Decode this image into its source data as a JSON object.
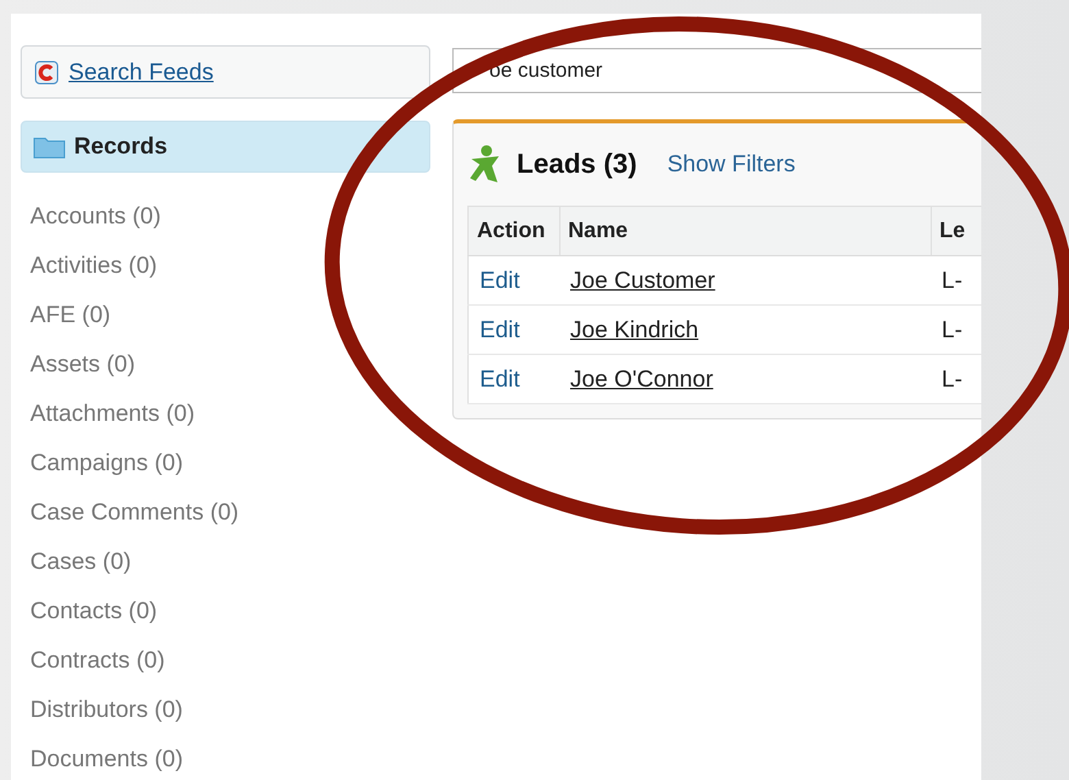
{
  "sidebar": {
    "search_feeds": "Search Feeds",
    "records_header": "Records",
    "items": [
      "Accounts (0)",
      "Activities (0)",
      "AFE (0)",
      "Assets (0)",
      "Attachments (0)",
      "Campaigns (0)",
      "Case Comments (0)",
      "Cases (0)",
      "Contacts (0)",
      "Contracts (0)",
      "Distributors (0)",
      "Documents (0)"
    ]
  },
  "search": {
    "value": "oe customer"
  },
  "leads": {
    "title": "Leads (3)",
    "filters_link": "Show Filters",
    "columns": [
      "Action",
      "Name",
      "Le"
    ],
    "rows": [
      {
        "action": "Edit",
        "name": "Joe Customer",
        "column_3": "L-"
      },
      {
        "action": "Edit",
        "name": "Joe Kindrich",
        "column_3": "L-"
      },
      {
        "action": "Edit",
        "name": "Joe O'Connor",
        "column_3": "L-"
      }
    ]
  },
  "annotation": {
    "kind": "ellipse"
  }
}
